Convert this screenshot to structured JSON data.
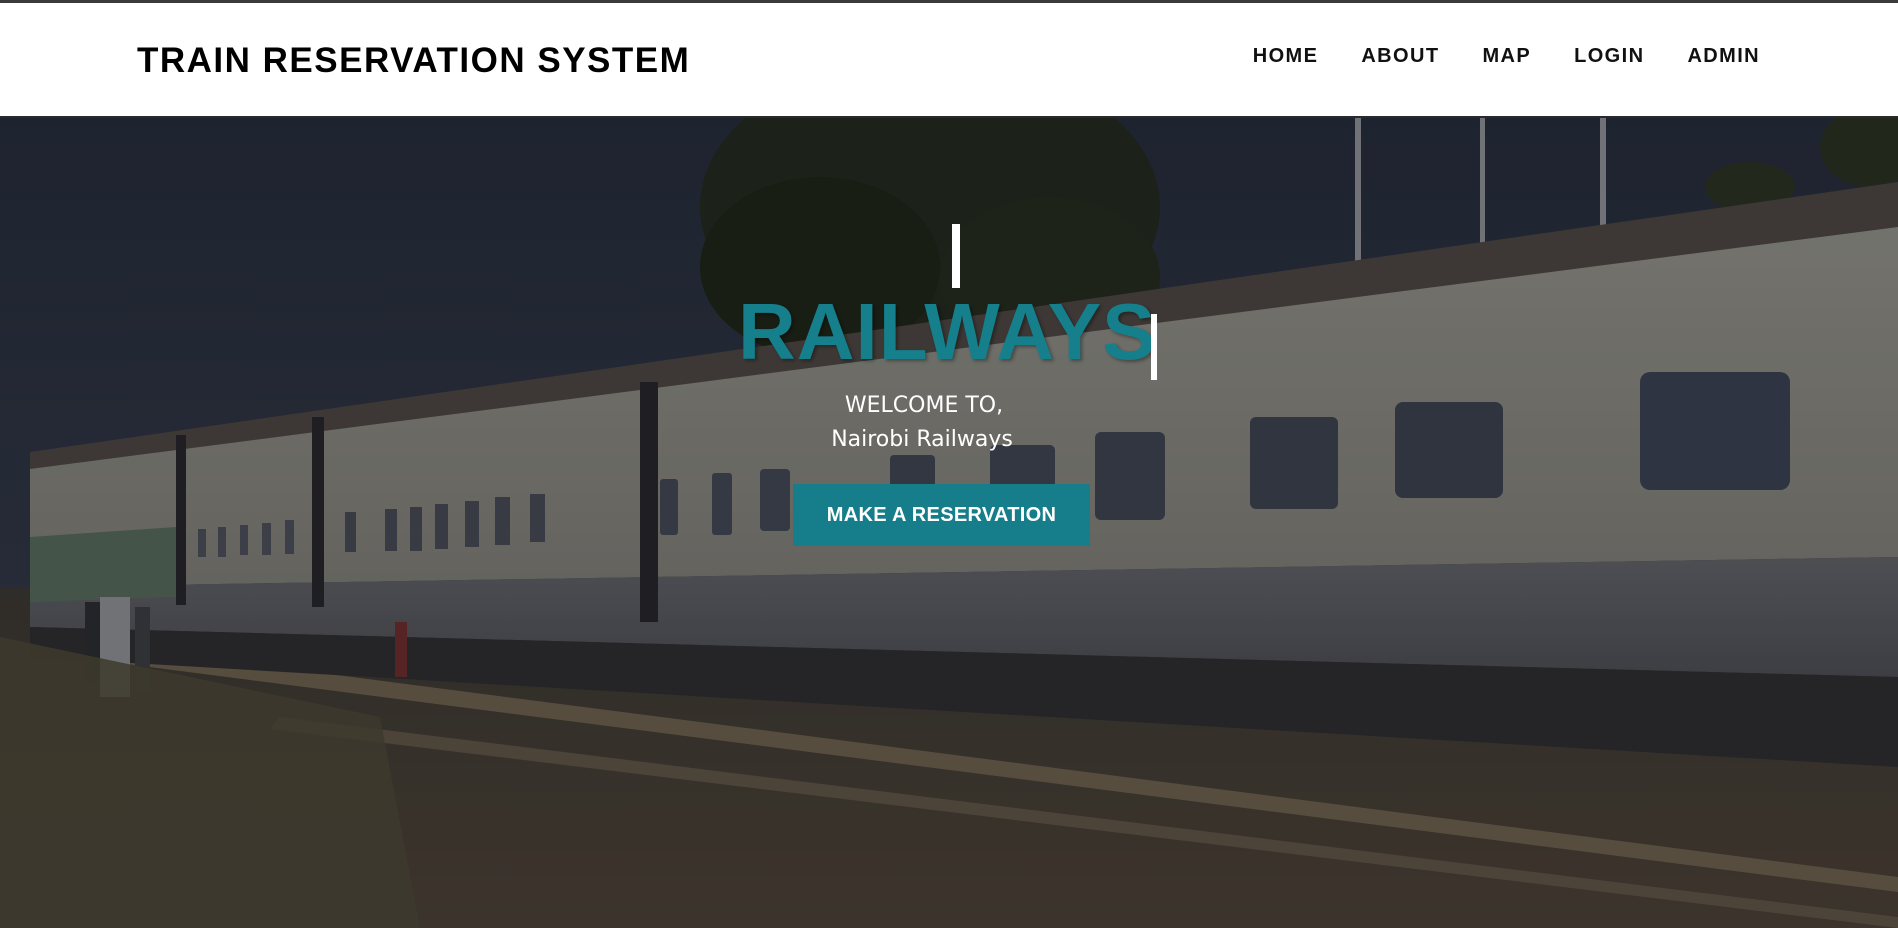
{
  "header": {
    "brand": "TRAIN RESERVATION SYSTEM",
    "nav": [
      {
        "label": "HOME"
      },
      {
        "label": "ABOUT"
      },
      {
        "label": "MAP"
      },
      {
        "label": "LOGIN"
      },
      {
        "label": "ADMIN"
      }
    ]
  },
  "hero": {
    "title": "RAILWAYS",
    "welcome_line1": "WELCOME TO,",
    "welcome_line2": "Nairobi Railways",
    "cta_label": "MAKE A RESERVATION"
  },
  "colors": {
    "accent": "#157f8c",
    "header_bg": "#ffffff",
    "text_on_hero": "#ffffff"
  }
}
